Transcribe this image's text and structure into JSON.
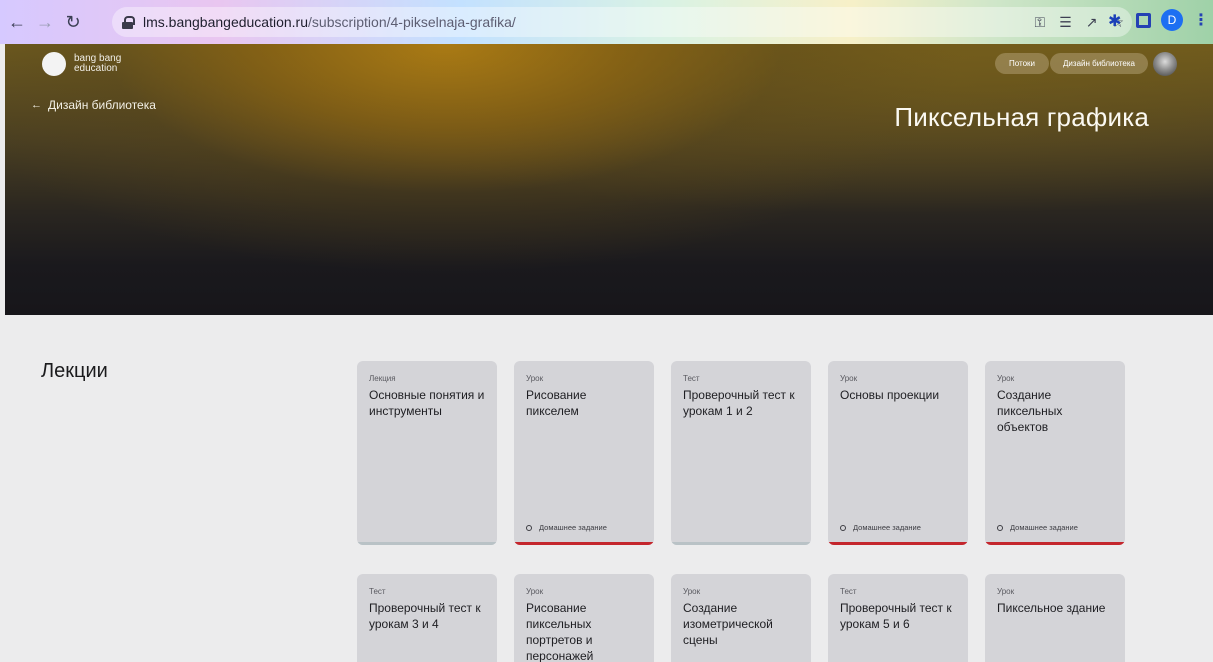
{
  "browser": {
    "url_host": "lms.bangbangeducation.ru",
    "url_path": "/subscription/4-pikselnaja-grafika/",
    "profile_initial": "D"
  },
  "header": {
    "logo_line1": "bang bang",
    "logo_line2": "education",
    "back_label": "Дизайн библиотека",
    "nav_pills": [
      "Потоки",
      "Дизайн библиотека"
    ],
    "page_title": "Пиксельная графика"
  },
  "section": {
    "title": "Лекции"
  },
  "cards": [
    {
      "type": "Лекция",
      "title": "Основные понятия и инструменты",
      "homework": "",
      "accent": "#b9c2c6"
    },
    {
      "type": "Урок",
      "title": "Рисование пикселем",
      "homework": "Домашнее задание",
      "accent": "#c4262d"
    },
    {
      "type": "Тест",
      "title": "Проверочный тест к урокам 1 и 2",
      "homework": "",
      "accent": "#b9c2c6"
    },
    {
      "type": "Урок",
      "title": "Основы проекции",
      "homework": "Домашнее задание",
      "accent": "#c4262d"
    },
    {
      "type": "Урок",
      "title": "Создание пиксельных объектов",
      "homework": "Домашнее задание",
      "accent": "#c4262d"
    },
    {
      "type": "Тест",
      "title": "Проверочный тест к урокам 3 и 4",
      "homework": "",
      "accent": ""
    },
    {
      "type": "Урок",
      "title": "Рисование пиксельных портретов и персонажей",
      "homework": "",
      "accent": ""
    },
    {
      "type": "Урок",
      "title": "Создание изометрической сцены",
      "homework": "",
      "accent": ""
    },
    {
      "type": "Тест",
      "title": "Проверочный тест к урокам 5 и 6",
      "homework": "",
      "accent": ""
    },
    {
      "type": "Урок",
      "title": "Пиксельное здание",
      "homework": "",
      "accent": ""
    }
  ]
}
